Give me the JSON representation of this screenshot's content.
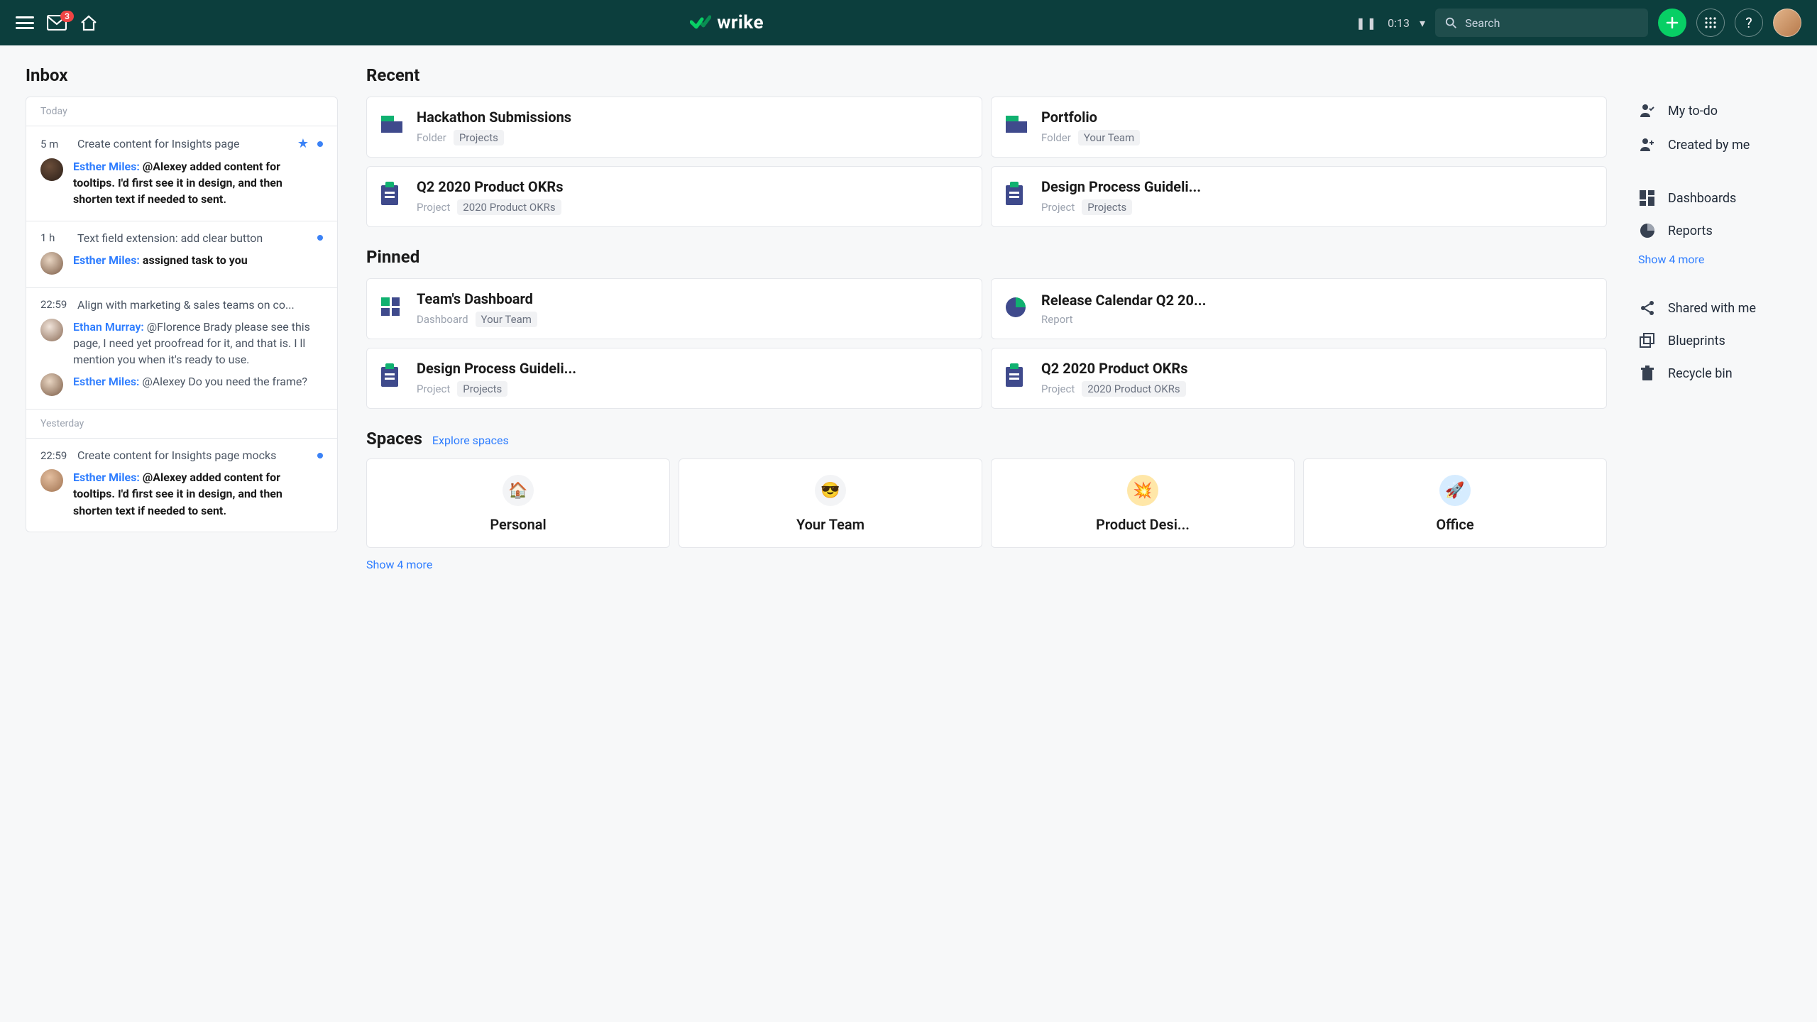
{
  "header": {
    "inbox_badge": "3",
    "brand": "wrike",
    "timer": "0:13",
    "search_placeholder": "Search"
  },
  "inbox": {
    "title": "Inbox",
    "sep_today": "Today",
    "sep_yesterday": "Yesterday",
    "items": {
      "a": {
        "time": "5 m",
        "title": "Create content for Insights page",
        "who": "Esther Miles:",
        "text": "@Alexey added content for tooltips. I'd first see it in design, and then shorten text if needed to sent."
      },
      "b": {
        "time": "1 h",
        "title": "Text field extension: add clear button",
        "who": "Esther Miles:",
        "text": "assigned task to you"
      },
      "c": {
        "time": "22:59",
        "title": "Align with marketing & sales teams on co...",
        "who1": "Ethan Murray:",
        "text1": "@Florence Brady please see this page, I need yet proofread for it, and that is. I ll mention you when it's ready to use.",
        "who2": "Esther Miles:",
        "text2": "@Alexey Do you need the frame?"
      },
      "d": {
        "time": "22:59",
        "title": "Create content for Insights page mocks",
        "who": "Esther Miles:",
        "text": "@Alexey added content for tooltips. I'd first see it in design, and then shorten text if needed to sent."
      }
    }
  },
  "recent": {
    "title": "Recent",
    "cards": {
      "a": {
        "title": "Hackathon Submissions",
        "type": "Folder",
        "chip": "Projects"
      },
      "b": {
        "title": "Portfolio",
        "type": "Folder",
        "chip": "Your Team"
      },
      "c": {
        "title": "Q2 2020 Product OKRs",
        "type": "Project",
        "chip": "2020 Product OKRs"
      },
      "d": {
        "title": "Design Process Guideli...",
        "type": "Project",
        "chip": "Projects"
      }
    }
  },
  "pinned": {
    "title": "Pinned",
    "cards": {
      "a": {
        "title": "Team's Dashboard",
        "type": "Dashboard",
        "chip": "Your Team"
      },
      "b": {
        "title": "Release Calendar Q2 20...",
        "type": "Report"
      },
      "c": {
        "title": "Design Process Guideli...",
        "type": "Project",
        "chip": "Projects"
      },
      "d": {
        "title": "Q2 2020 Product OKRs",
        "type": "Project",
        "chip": "2020 Product OKRs"
      }
    }
  },
  "spaces": {
    "title": "Spaces",
    "explore": "Explore spaces",
    "show_more": "Show 4 more",
    "items": {
      "a": {
        "emoji": "🏠",
        "label": "Personal"
      },
      "b": {
        "emoji": "😎",
        "label": "Your Team"
      },
      "c": {
        "emoji": "💥",
        "label": "Product Desi..."
      },
      "d": {
        "emoji": "🚀",
        "label": "Office"
      }
    }
  },
  "side": {
    "todo": "My to-do",
    "created": "Created by me",
    "dashboards": "Dashboards",
    "reports": "Reports",
    "show_more": "Show 4 more",
    "shared": "Shared with me",
    "blueprints": "Blueprints",
    "recycle": "Recycle bin"
  }
}
